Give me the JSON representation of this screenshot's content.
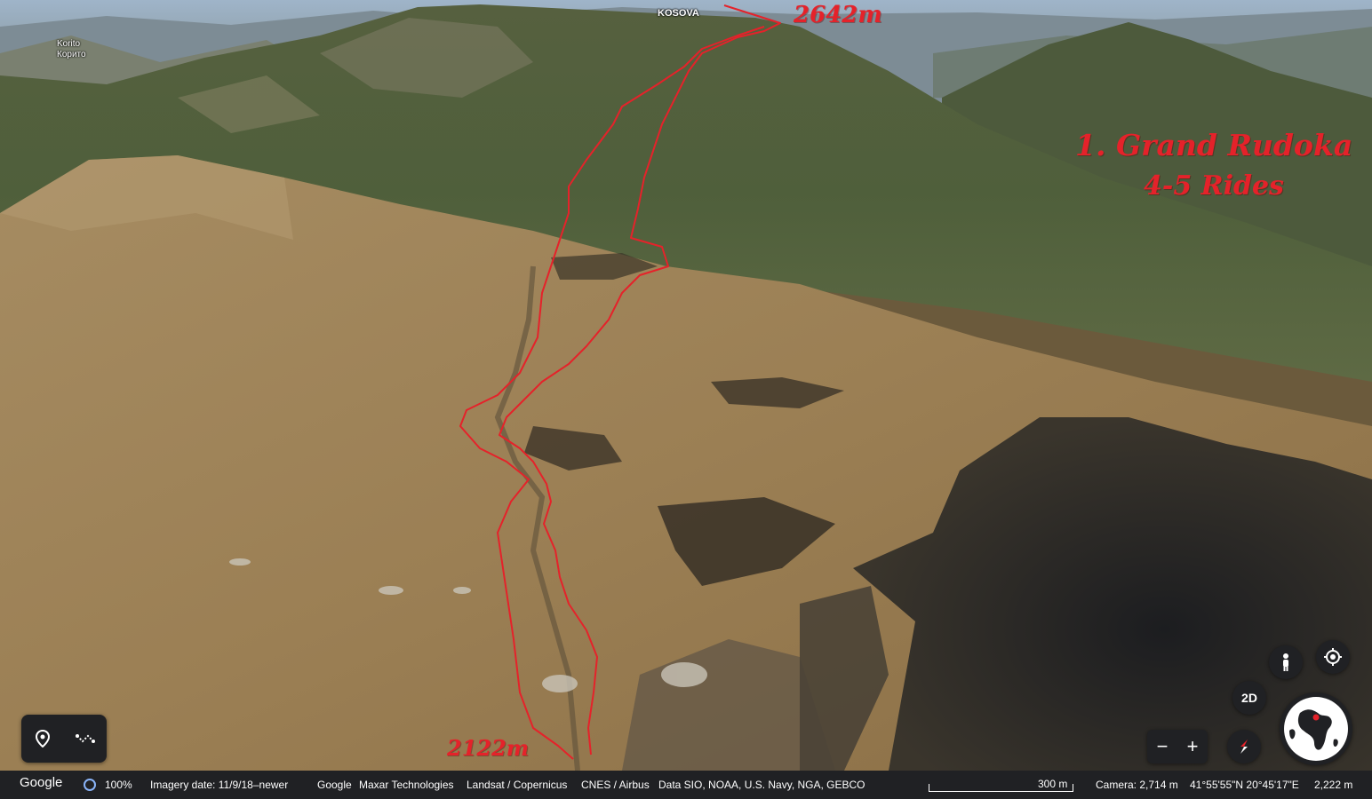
{
  "map": {
    "place_labels": {
      "korito_latin": "Korito",
      "korito_cyrillic": "Корито",
      "kosova": "KOSOVA"
    },
    "annotations": {
      "summit_elevation": "2642m",
      "base_elevation": "2122m",
      "route_title": "1. Grand Rudoka",
      "route_rides": "4-5 Rides"
    },
    "route_color": "#e5222a"
  },
  "toolbar": {
    "places_icon": "location-pin-icon",
    "measure_icon": "measure-path-icon"
  },
  "controls": {
    "mode_label": "2D",
    "zoom_out_label": "−",
    "zoom_in_label": "+",
    "pegman_icon": "pegman-icon",
    "my_location_icon": "my-location-icon",
    "compass_icon": "compass-icon",
    "globe_icon": "globe-icon"
  },
  "status_bar": {
    "logo": "Google",
    "load_progress": "100%",
    "imagery_date": "Imagery date: 11/9/18–newer",
    "credits": {
      "google": "Google",
      "maxar": "Maxar Technologies",
      "landsat": "Landsat / Copernicus",
      "cnes": "CNES / Airbus",
      "data": "Data SIO, NOAA, U.S. Navy, NGA, GEBCO"
    },
    "scale": "300 m",
    "camera": "Camera: 2,714 m",
    "coordinates": "41°55'55\"N 20°45'17\"E",
    "elevation": "2,222 m"
  }
}
